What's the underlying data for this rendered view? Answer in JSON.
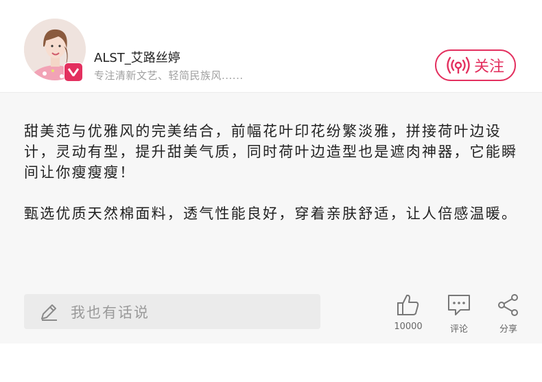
{
  "header": {
    "username": "ALST_艾路丝婷",
    "signature": "专注清新文艺、轻简民族风......",
    "follow_label": "关注",
    "accent_color": "#e3305f",
    "avatar_icon": "avatar",
    "badge_icon": "v-verified-icon"
  },
  "post": {
    "paragraph1": "甜美范与优雅风的完美结合，前幅花叶印花纷繁淡雅，拼接荷叶边设计，灵动有型，提升甜美气质，同时荷叶边造型也是遮肉神器，它能瞬间让你瘦瘦瘦！",
    "paragraph2": "甄选优质天然棉面料，透气性能良好，穿着亲肤舒适，让人倍感温暖。"
  },
  "footer": {
    "comment_placeholder": "我也有话说",
    "like_count": "10000",
    "comment_label": "评论",
    "share_label": "分享"
  }
}
